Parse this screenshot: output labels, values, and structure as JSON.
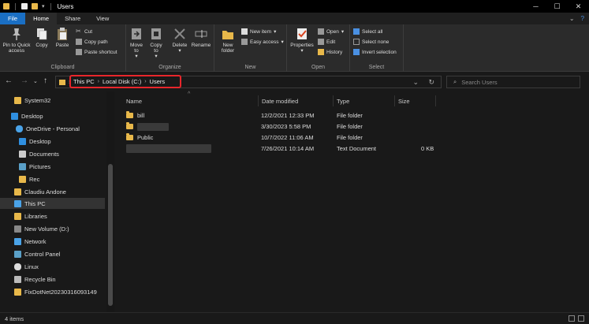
{
  "window": {
    "title": "Users"
  },
  "tabs": {
    "file": "File",
    "home": "Home",
    "share": "Share",
    "view": "View"
  },
  "ribbon": {
    "clipboard": {
      "label": "Clipboard",
      "pin": "Pin to Quick access",
      "copy": "Copy",
      "paste": "Paste",
      "cut": "Cut",
      "copy_path": "Copy path",
      "paste_shortcut": "Paste shortcut"
    },
    "organize": {
      "label": "Organize",
      "move_to": "Move to",
      "copy_to": "Copy to",
      "delete": "Delete",
      "rename": "Rename"
    },
    "new": {
      "label": "New",
      "new_folder": "New folder",
      "new_item": "New item",
      "easy_access": "Easy access"
    },
    "open": {
      "label": "Open",
      "properties": "Properties",
      "open": "Open",
      "edit": "Edit",
      "history": "History"
    },
    "select": {
      "label": "Select",
      "select_all": "Select all",
      "select_none": "Select none",
      "invert": "Invert selection"
    }
  },
  "address": {
    "crumbs": [
      "This PC",
      "Local Disk (C:)",
      "Users"
    ],
    "search_placeholder": "Search Users"
  },
  "nav": [
    {
      "label": "System32",
      "icon": "folder-icon"
    },
    {
      "label": "Desktop",
      "icon": "desktop-icon"
    },
    {
      "label": "OneDrive - Personal",
      "icon": "cloud-icon"
    },
    {
      "label": "Desktop",
      "icon": "desktop-icon"
    },
    {
      "label": "Documents",
      "icon": "documents-icon"
    },
    {
      "label": "Pictures",
      "icon": "pictures-icon"
    },
    {
      "label": "Rec",
      "icon": "folder-icon"
    },
    {
      "label": "Claudiu Andone",
      "icon": "user-folder-icon"
    },
    {
      "label": "This PC",
      "icon": "pc-icon"
    },
    {
      "label": "Libraries",
      "icon": "libraries-icon"
    },
    {
      "label": "New Volume (D:)",
      "icon": "drive-icon"
    },
    {
      "label": "Network",
      "icon": "network-icon"
    },
    {
      "label": "Control Panel",
      "icon": "control-panel-icon"
    },
    {
      "label": "Linux",
      "icon": "linux-icon"
    },
    {
      "label": "Recycle Bin",
      "icon": "recycle-bin-icon"
    },
    {
      "label": "FixDotNet20230316093149",
      "icon": "folder-icon"
    }
  ],
  "columns": {
    "name": "Name",
    "date": "Date modified",
    "type": "Type",
    "size": "Size"
  },
  "files": [
    {
      "name": "bill",
      "date": "12/2/2021 12:33 PM",
      "type": "File folder",
      "size": ""
    },
    {
      "name": "",
      "date": "3/30/2023 5:58 PM",
      "type": "File folder",
      "size": ""
    },
    {
      "name": "Public",
      "date": "10/7/2022 11:06 AM",
      "type": "File folder",
      "size": ""
    },
    {
      "name": "",
      "date": "7/26/2021 10:14 AM",
      "type": "Text Document",
      "size": "0 KB"
    }
  ],
  "status": {
    "count": "4 items"
  },
  "colors": {
    "accent": "#1a6fc4",
    "highlight": "#e8262b",
    "folder": "#e8b84a"
  }
}
